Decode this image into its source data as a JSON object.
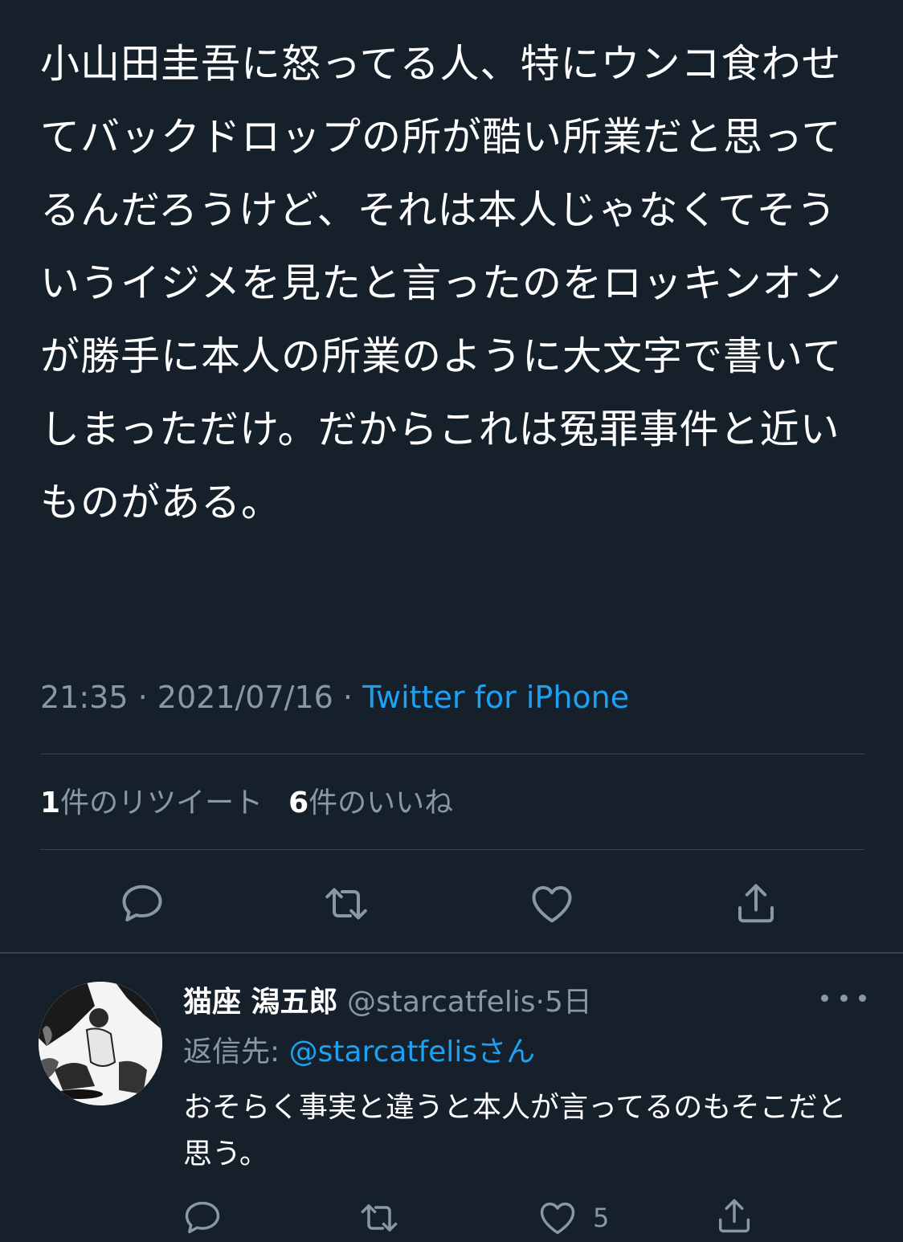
{
  "tweet": {
    "text": "小山田圭吾に怒ってる人、特にウンコ食わせてバックドロップの所が酷い所業だと思ってるんだろうけど、それは本人じゃなくてそういうイジメを見たと言ったのをロッキンオンが勝手に本人の所業のように大文字で書いてしまっただけ。だからこれは冤罪事件と近いものがある。",
    "time": "21:35",
    "separator": "·",
    "date": "2021/07/16",
    "source": "Twitter for iPhone"
  },
  "stats": {
    "retweet_count": "1",
    "retweet_label": "件のリツイート",
    "like_count": "6",
    "like_label": "件のいいね"
  },
  "actions": {
    "reply_icon": "reply-icon",
    "retweet_icon": "retweet-icon",
    "like_icon": "heart-icon",
    "share_icon": "share-icon"
  },
  "reply": {
    "name": "猫座 潟五郎",
    "handle": "@starcatfelis",
    "separator": "·",
    "time": "5日",
    "reply_to_label": "返信先: ",
    "reply_to_handle": "@starcatfelis",
    "reply_to_suffix": "さん",
    "text": "おそらく事実と違うと本人が言ってるのもそこだと思う。",
    "like_count": "5"
  },
  "colors": {
    "background": "#15202b",
    "text": "#ffffff",
    "secondary": "#8899a6",
    "accent": "#1da1f2",
    "divider": "#38444d"
  }
}
